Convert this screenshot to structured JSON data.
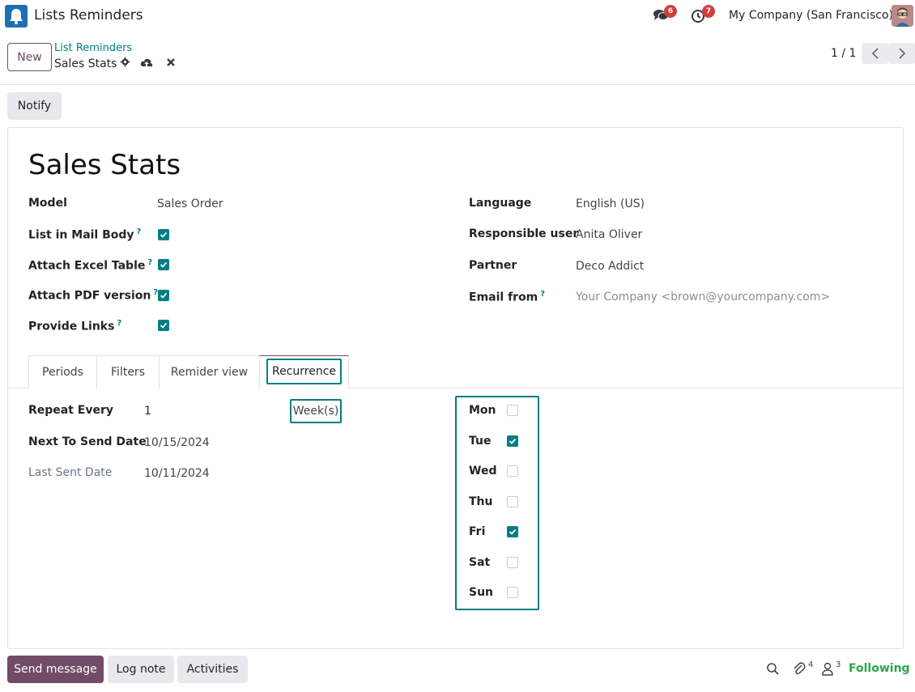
{
  "topbar": {
    "app_title": "Lists Reminders",
    "messages_count": "6",
    "activities_count": "7",
    "company": "My Company (San Francisco)"
  },
  "control_panel": {
    "new_label": "New",
    "breadcrumb_parent": "List Reminders",
    "breadcrumb_current": "Sales Stats",
    "pager": "1 / 1"
  },
  "status_bar": {
    "notify_label": "Notify"
  },
  "form": {
    "title": "Sales Stats",
    "left_fields": [
      {
        "label": "Model",
        "value": "Sales Order"
      },
      {
        "label": "List in Mail Body",
        "help": "?",
        "checked": true
      },
      {
        "label": "Attach Excel Table",
        "help": "?",
        "checked": true
      },
      {
        "label": "Attach PDF version",
        "help": "?",
        "checked": true
      },
      {
        "label": "Provide Links",
        "help": "?",
        "checked": true
      }
    ],
    "right_fields": [
      {
        "label": "Language",
        "value": "English (US)"
      },
      {
        "label": "Responsible user",
        "value": "Anita Oliver"
      },
      {
        "label": "Partner",
        "value": "Deco Addict"
      },
      {
        "label": "Email from",
        "help": "?",
        "value": "Your Company <brown@yourcompany.com>"
      }
    ]
  },
  "tabs": [
    "Periods",
    "Filters",
    "Remider view",
    "Recurrence"
  ],
  "recurrence": {
    "repeat_every_label": "Repeat Every",
    "repeat_every_value": "1",
    "unit": "Week(s)",
    "next_send_label": "Next To Send Date",
    "next_send_value": "10/15/2024",
    "last_sent_label": "Last Sent Date",
    "last_sent_value": "10/11/2024",
    "days": [
      {
        "label": "Mon",
        "checked": false
      },
      {
        "label": "Tue",
        "checked": true
      },
      {
        "label": "Wed",
        "checked": false
      },
      {
        "label": "Thu",
        "checked": false
      },
      {
        "label": "Fri",
        "checked": true
      },
      {
        "label": "Sat",
        "checked": false
      },
      {
        "label": "Sun",
        "checked": false
      }
    ]
  },
  "chatter": {
    "send_label": "Send message",
    "log_label": "Log note",
    "activities_label": "Activities",
    "attachments_count": "4",
    "followers_count": "3",
    "following_label": "Following"
  },
  "colors": {
    "primary": "#714b67",
    "accent": "#017e84",
    "badge": "#d23f3a",
    "following": "#28a745"
  }
}
